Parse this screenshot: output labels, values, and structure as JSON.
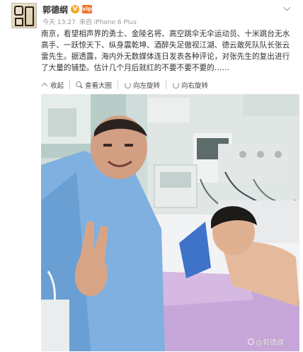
{
  "post": {
    "author": "郭德纲",
    "verified_badge": "V",
    "member_badge": "vip",
    "time": "今天 13:27",
    "source": "来自 iPhone 6 Plus",
    "text": "南京，看望相声界的勇士、金陵名将、高空跳伞无伞运动员、十米跳台无水高手、一跃惊天下、纵身震乾坤、酒醉失足傲视江湖、德云敢死队队长张云雷先生。据透露，海内外无数媒体连日发表各种评论，对张先生的复出进行了大量的铺垫。估计几个月后就红的不要不要不要的……"
  },
  "toolbar": {
    "collapse_label": "收起",
    "view_large_label": "查看大图",
    "rotate_left_label": "向左旋转",
    "rotate_right_label": "向右旋转"
  },
  "photo": {
    "watermark": "@郭德纲"
  },
  "icons": {
    "menu": "chevron-down-icon",
    "collapse": "collapse-arrow-icon",
    "zoom": "magnifier-icon",
    "rotate_left": "rotate-left-icon",
    "rotate_right": "rotate-right-icon"
  }
}
